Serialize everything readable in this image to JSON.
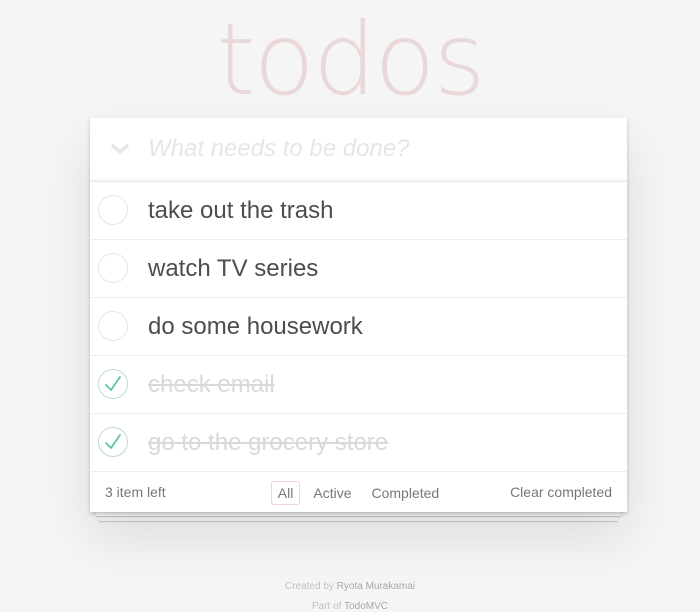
{
  "app": {
    "title": "todos"
  },
  "header": {
    "toggle_all_icon": "chevron-down-icon",
    "new_todo_placeholder": "What needs to be done?",
    "new_todo_value": ""
  },
  "todos": [
    {
      "label": "take out the trash",
      "completed": false
    },
    {
      "label": "watch TV series",
      "completed": false
    },
    {
      "label": "do some housework",
      "completed": false
    },
    {
      "label": "check email",
      "completed": true
    },
    {
      "label": "go to the grocery store",
      "completed": true
    }
  ],
  "footer": {
    "count_text": "3 item left",
    "filters": [
      {
        "label": "All",
        "selected": true
      },
      {
        "label": "Active",
        "selected": false
      },
      {
        "label": "Completed",
        "selected": false
      }
    ],
    "clear_completed_label": "Clear completed"
  },
  "info": {
    "created_by_prefix": "Created by",
    "author": "Ryota Murakamai",
    "part_of_prefix": "Part of",
    "project": "TodoMVC"
  },
  "colors": {
    "title": "#efd5d5",
    "check_green": "#5dc2af",
    "check_border": "#bddad5",
    "selected_filter_border": "#efd5d5",
    "background": "#f5f5f5"
  }
}
